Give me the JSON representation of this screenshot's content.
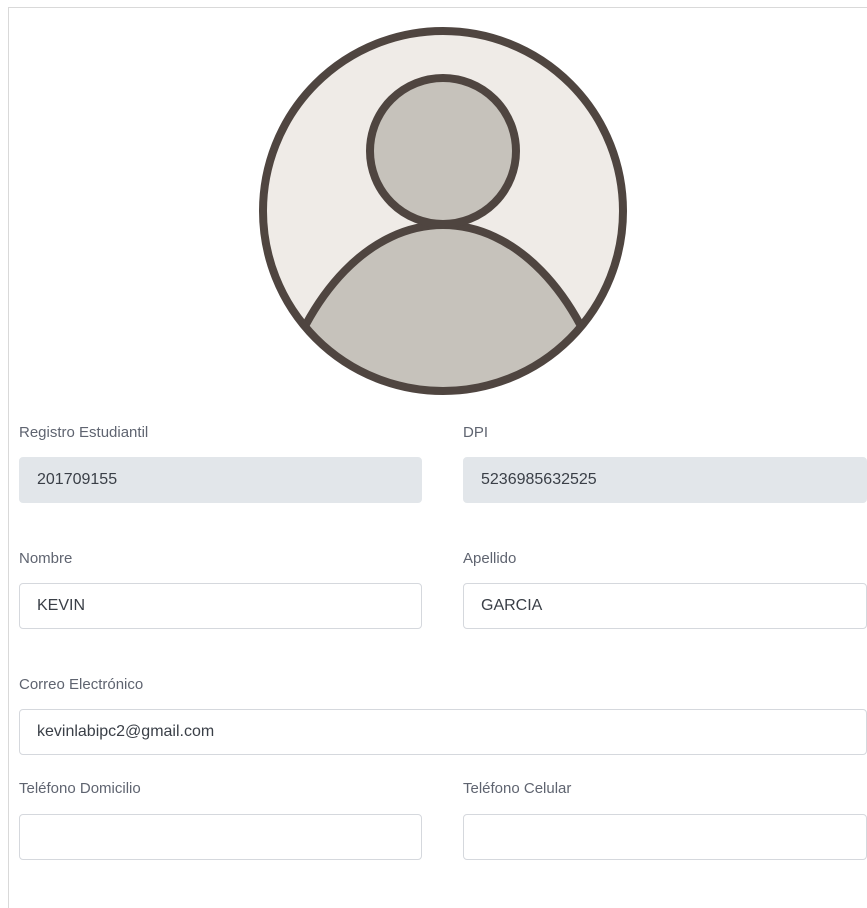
{
  "profile": {
    "avatar_icon": "user-avatar-placeholder-icon",
    "colors": {
      "avatar_outline": "#4f4540",
      "avatar_background": "#efebe7",
      "avatar_figure": "#c6c2bb"
    }
  },
  "form": {
    "registro": {
      "label": "Registro Estudiantil",
      "value": "201709155"
    },
    "dpi": {
      "label": "DPI",
      "value": "5236985632525"
    },
    "nombre": {
      "label": "Nombre",
      "value": "KEVIN"
    },
    "apellido": {
      "label": "Apellido",
      "value": "GARCIA"
    },
    "correo": {
      "label": "Correo Electrónico",
      "value": "kevinlabipc2@gmail.com"
    },
    "telefono_domicilio": {
      "label": "Teléfono Domicilio",
      "value": ""
    },
    "telefono_celular": {
      "label": "Teléfono Celular",
      "value": ""
    }
  },
  "colors": {
    "readonly_field_bg": "#e2e6ea",
    "field_border": "#d5d8dd",
    "label_text": "#5f6470"
  }
}
